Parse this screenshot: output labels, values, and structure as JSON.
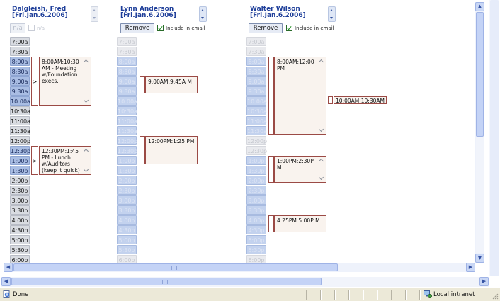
{
  "columns": [
    {
      "name": "Dalgleish, Fred",
      "date": "[Fri.Jan.6.2006]",
      "button_label": "n/a",
      "checkbox_label": "n/a",
      "checkbox_checked": false,
      "enabled": false,
      "slots": [
        "7:00a",
        "7:30a",
        "8:00a",
        "8:30a",
        "9:00a",
        "9:30a",
        "10:00a",
        "10:30a",
        "11:00a",
        "11:30a",
        "12:00p",
        "12:30p",
        "1:00p",
        "1:30p",
        "2:00p",
        "2:30p",
        "3:00p",
        "3:30p",
        "4:00p",
        "4:30p",
        "5:00p",
        "5:30p",
        "6:00p"
      ],
      "appointments": [
        {
          "text": "8:00AM:10:30 AM - Meeting w/Foundation execs.",
          "tab": ">"
        },
        {
          "text": "12:30PM:1:45 PM - Lunch w/Auditors (keep it quick)",
          "tab": ">"
        }
      ]
    },
    {
      "name": "Lynn Anderson",
      "date": "[Fri.Jan.6.2006]",
      "button_label": "Remove",
      "checkbox_label": "Include in email",
      "checkbox_checked": true,
      "enabled": true,
      "slots": [
        "7:00a",
        "7:30a",
        "8:00a",
        "8:30a",
        "9:00a",
        "9:30a",
        "10:00a",
        "10:30a",
        "11:00a",
        "11:30a",
        "12:00p",
        "12:30p",
        "1:00p",
        "1:30p",
        "2:00p",
        "2:30p",
        "3:00p",
        "3:30p",
        "4:00p",
        "4:30p",
        "5:00p",
        "5:30p",
        "6:00p"
      ],
      "appointments": [
        {
          "text": "9:00AM:9:45A M",
          "tab": ""
        },
        {
          "text": "12:00PM:1:25 PM",
          "tab": ""
        }
      ]
    },
    {
      "name": "Walter Wilson",
      "date": "[Fri.Jan.6.2006]",
      "button_label": "Remove",
      "checkbox_label": "Include in email",
      "checkbox_checked": true,
      "enabled": true,
      "slots": [
        "7:00a",
        "7:30a",
        "8:00a",
        "8:30a",
        "9:00a",
        "9:30a",
        "10:00a",
        "10:30a",
        "11:00a",
        "11:30a",
        "12:00p",
        "12:30p",
        "1:00p",
        "1:30p",
        "2:00p",
        "2:30p",
        "3:00p",
        "3:30p",
        "4:00p",
        "4:30p",
        "5:00p",
        "5:30p",
        "6:00p"
      ],
      "appointments": [
        {
          "text": "8:00AM:12:00 PM",
          "tab": ""
        },
        {
          "text": "10:00AM:10:30AM",
          "tab": ""
        },
        {
          "text": "1:00PM:2:30P M",
          "tab": ""
        },
        {
          "text": "4:25PM:5:00P M",
          "tab": ""
        }
      ]
    }
  ],
  "status": {
    "text": "Done",
    "zone": "Local intranet"
  },
  "colors": {
    "name_blue": "#1f3f9a",
    "slot_blue": "#a9bde3",
    "appointment_border": "#9b4a45",
    "appointment_fill": "#f9f3ee"
  }
}
